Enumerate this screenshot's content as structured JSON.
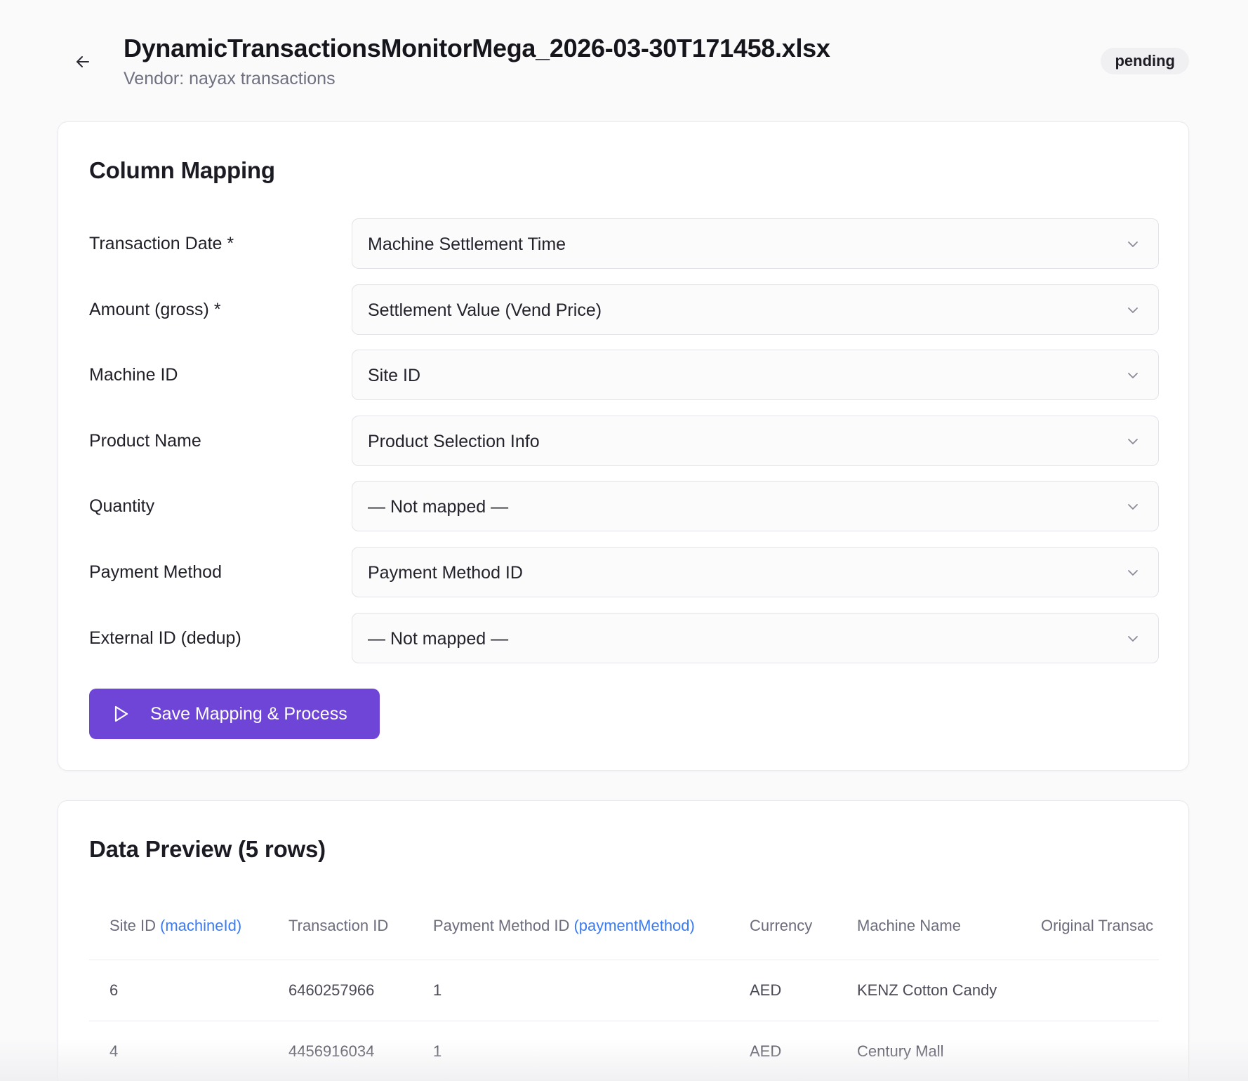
{
  "header": {
    "back_icon": "arrow-left-icon",
    "title": "DynamicTransactionsMonitorMega_2026-03-30T171458.xlsx",
    "subtitle": "Vendor: nayax transactions",
    "status": "pending"
  },
  "mapping": {
    "title": "Column Mapping",
    "rows": [
      {
        "label": "Transaction Date *",
        "value": "Machine Settlement Time"
      },
      {
        "label": "Amount (gross) *",
        "value": "Settlement Value (Vend Price)"
      },
      {
        "label": "Machine ID",
        "value": "Site ID"
      },
      {
        "label": "Product Name",
        "value": "Product Selection Info"
      },
      {
        "label": "Quantity",
        "value": "— Not mapped —"
      },
      {
        "label": "Payment Method",
        "value": "Payment Method ID"
      },
      {
        "label": "External ID (dedup)",
        "value": "— Not mapped —"
      }
    ],
    "save_button": "Save Mapping & Process"
  },
  "preview": {
    "title": "Data Preview (5 rows)",
    "columns": [
      {
        "name": "Site ID",
        "mapped": "(machineId)"
      },
      {
        "name": "Transaction ID",
        "mapped": ""
      },
      {
        "name": "Payment Method ID",
        "mapped": "(paymentMethod)"
      },
      {
        "name": "Currency",
        "mapped": ""
      },
      {
        "name": "Machine Name",
        "mapped": ""
      },
      {
        "name": "Original Transac",
        "mapped": ""
      }
    ],
    "rows": [
      [
        "6",
        "6460257966",
        "1",
        "AED",
        "KENZ Cotton Candy",
        ""
      ],
      [
        "4",
        "4456916034",
        "1",
        "AED",
        "Century Mall",
        ""
      ]
    ]
  },
  "colors": {
    "accent": "#6f45d8",
    "mapped_tag": "#3b7bf2",
    "badge_bg": "#f0f0f3",
    "page_bg": "#fafafb"
  }
}
